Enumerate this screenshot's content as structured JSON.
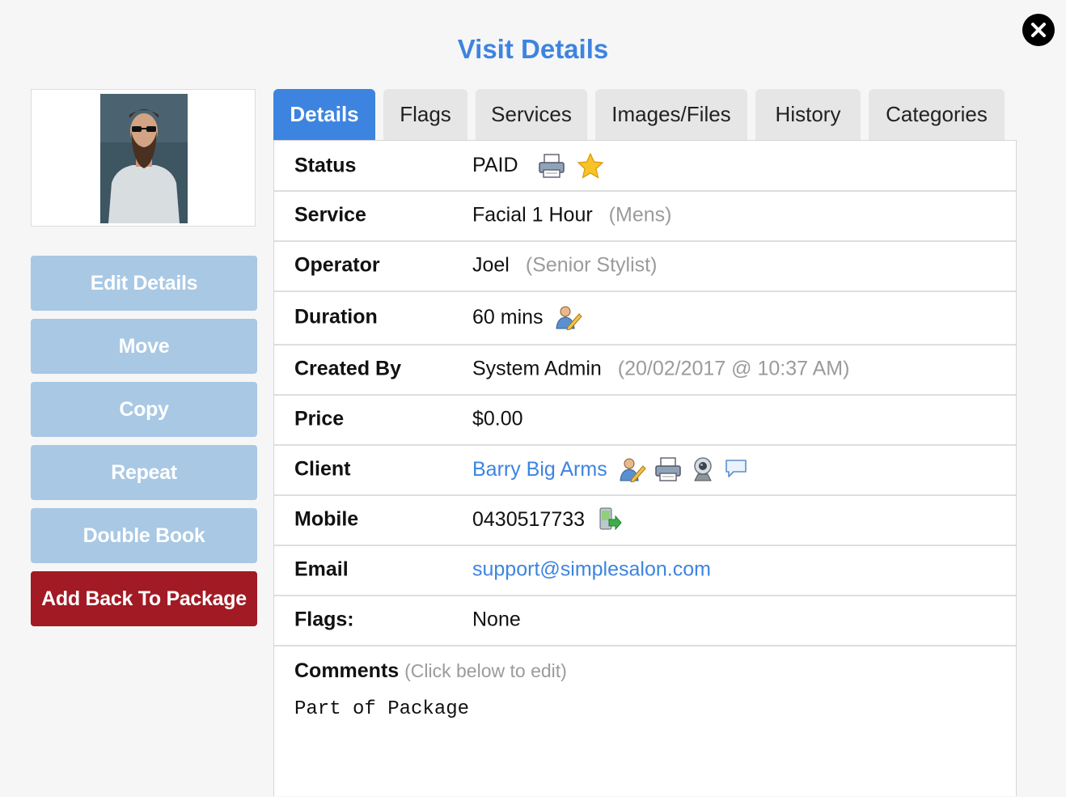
{
  "title": "Visit Details",
  "colors": {
    "accent": "#3d84e0",
    "button_light": "#a8c8e4",
    "button_danger": "#a11a24",
    "muted": "#9b9b9b"
  },
  "actions": {
    "edit": "Edit Details",
    "move": "Move",
    "copy": "Copy",
    "repeat": "Repeat",
    "double_book": "Double Book",
    "add_back": "Add Back To Package"
  },
  "tabs": [
    "Details",
    "Flags",
    "Services",
    "Images/Files",
    "History",
    "Categories"
  ],
  "details": {
    "status": {
      "label": "Status",
      "value": "PAID",
      "icons": [
        "printer-icon",
        "star-icon"
      ]
    },
    "service": {
      "label": "Service",
      "value": "Facial 1 Hour",
      "note": "(Mens)"
    },
    "operator": {
      "label": "Operator",
      "value": "Joel",
      "note": "(Senior Stylist)"
    },
    "duration": {
      "label": "Duration",
      "value": "60 mins",
      "icons": [
        "edit-user-icon"
      ]
    },
    "created_by": {
      "label": "Created By",
      "value": "System Admin",
      "note": "(20/02/2017 @ 10:37 AM)"
    },
    "price": {
      "label": "Price",
      "value": "$0.00"
    },
    "client": {
      "label": "Client",
      "value": "Barry Big Arms",
      "icons": [
        "edit-user-icon",
        "printer-icon",
        "webcam-icon",
        "chat-bubble-icon"
      ]
    },
    "mobile": {
      "label": "Mobile",
      "value": "0430517733",
      "icons": [
        "send-sms-icon"
      ]
    },
    "email": {
      "label": "Email",
      "value": "support@simplesalon.com"
    },
    "flags": {
      "label": "Flags:",
      "value": "None"
    },
    "comments": {
      "label": "Comments",
      "hint": "(Click below to edit)",
      "text": "Part of Package"
    }
  }
}
